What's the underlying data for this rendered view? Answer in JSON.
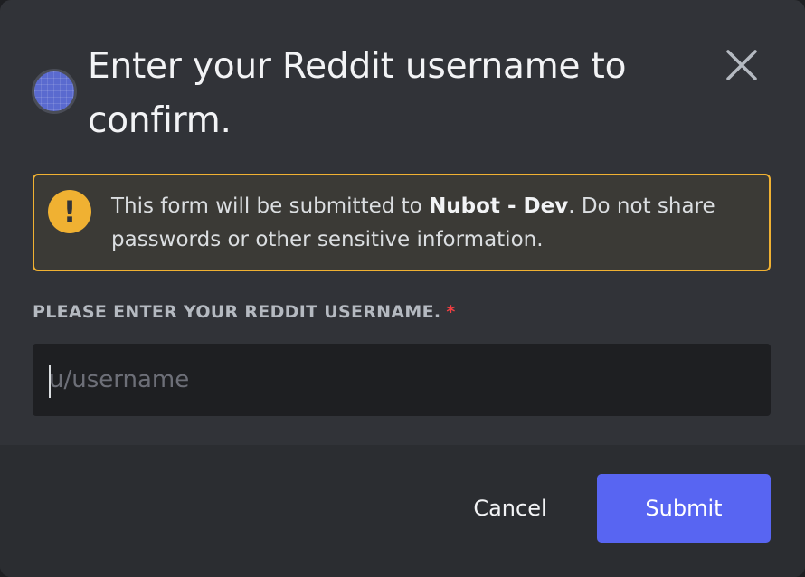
{
  "modal": {
    "title": "Enter your Reddit username to confirm.",
    "app_icon": "app-avatar-icon",
    "close_icon": "close-icon"
  },
  "warning": {
    "icon": "exclamation-icon",
    "text_before": "This form will be submitted to ",
    "app_name": "Nubot - Dev",
    "text_after": ". Do not share passwords or other sensitive information."
  },
  "field": {
    "label": "PLEASE ENTER YOUR REDDIT USERNAME.",
    "required_mark": "*",
    "placeholder": "u/username",
    "value": ""
  },
  "footer": {
    "cancel_label": "Cancel",
    "submit_label": "Submit"
  },
  "colors": {
    "accent": "#5865f2",
    "warning": "#f0b132",
    "required": "#f23f42"
  }
}
